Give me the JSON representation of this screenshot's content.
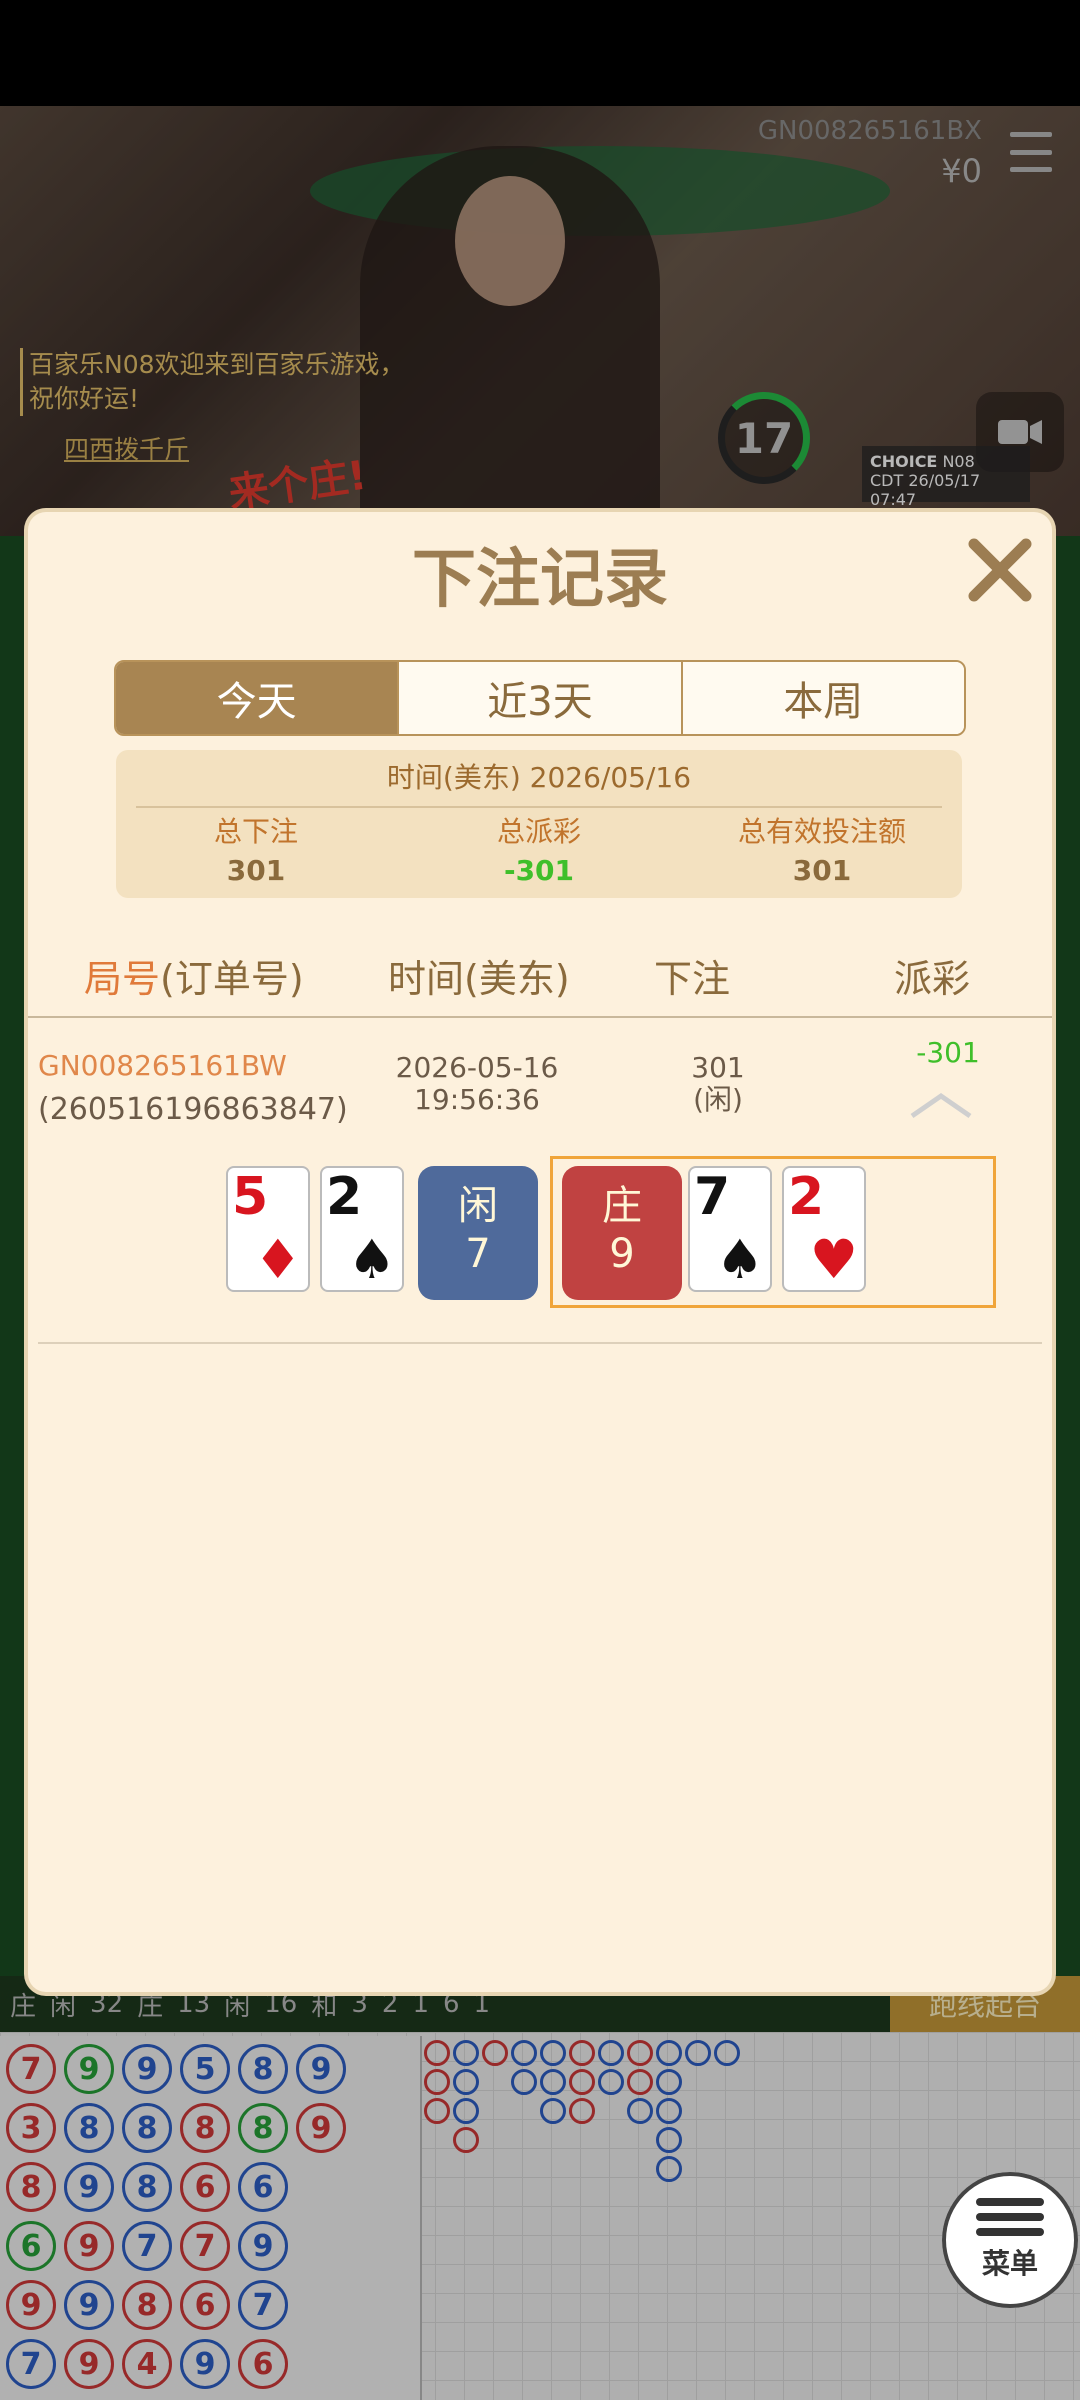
{
  "header": {
    "room_id": "GN008265161BX",
    "balance": "¥0",
    "timer": "17",
    "welcome_name": "百家乐N08",
    "welcome_text": "欢迎来到百家乐游戏，祝你好运!",
    "user_tag": "四西拨千斤",
    "choice_brand": "CHOICE",
    "choice_table": "N08",
    "choice_date": "CDT 26/05/17 07:47",
    "slogan": "来个庄!"
  },
  "modal": {
    "title": "下注记录",
    "tabs": [
      {
        "label": "今天",
        "active": true
      },
      {
        "label": "近3天",
        "active": false
      },
      {
        "label": "本周",
        "active": false
      }
    ],
    "summary": {
      "date_label": "时间(美东) 2026/05/16",
      "total_bet_label": "总下注",
      "total_bet_value": "301",
      "total_payout_label": "总派彩",
      "total_payout_value": "-301",
      "total_valid_label": "总有效投注额",
      "total_valid_value": "301"
    },
    "columns": {
      "id_em": "局号",
      "id_rest": "(订单号)",
      "time": "时间(美东)",
      "bet": "下注",
      "payout": "派彩"
    },
    "rows": [
      {
        "round_id": "GN008265161BW",
        "order_id": "(260516196863847)",
        "date": "2026-05-16",
        "time": "19:56:36",
        "bet_amount": "301",
        "bet_side": "(闲)",
        "payout": "-301",
        "player_cards": [
          {
            "rank": "5",
            "suit": "♦",
            "color": "red"
          },
          {
            "rank": "2",
            "suit": "♠",
            "color": "black"
          }
        ],
        "player_label": "闲",
        "player_score": "7",
        "banker_label": "庄",
        "banker_score": "9",
        "banker_cards": [
          {
            "rank": "7",
            "suit": "♠",
            "color": "black"
          },
          {
            "rank": "2",
            "suit": "♥",
            "color": "red"
          }
        ]
      }
    ]
  },
  "bottom": {
    "stats": {
      "banker_label": "庄",
      "player_label": "闲",
      "total": "32",
      "banker_count_label": "庄",
      "banker_count": "13",
      "player_count_label": "闲",
      "player_count": "16",
      "tie_label": "和",
      "tie_count": "3",
      "pair_a": "2",
      "pair_b": "1",
      "pair_c": "6",
      "pair_d": "1"
    },
    "go_road_label": "跑线起台",
    "menu_label": "菜单",
    "bead_rows": [
      [
        "7",
        "9",
        "9",
        "5",
        "8",
        "9"
      ],
      [
        "3",
        "8",
        "8",
        "8",
        "8",
        "9"
      ],
      [
        "8",
        "9",
        "8",
        "6",
        "6"
      ],
      [
        "6",
        "9",
        "7",
        "7",
        "9"
      ],
      [
        "9",
        "9",
        "8",
        "6",
        "7"
      ],
      [
        "7",
        "9",
        "4",
        "9",
        "6"
      ]
    ],
    "bead_colors": [
      [
        "red",
        "green",
        "blue",
        "blue",
        "blue",
        "blue"
      ],
      [
        "red",
        "blue",
        "blue",
        "red",
        "green",
        "red"
      ],
      [
        "red",
        "blue",
        "blue",
        "red",
        "blue"
      ],
      [
        "green",
        "red",
        "blue",
        "red",
        "blue"
      ],
      [
        "red",
        "blue",
        "red",
        "red",
        "blue"
      ],
      [
        "blue",
        "red",
        "red",
        "blue",
        "red"
      ]
    ],
    "colors": {
      "banker": "#d23a3a",
      "player": "#2d5fc7",
      "tie": "#27a33a"
    }
  }
}
